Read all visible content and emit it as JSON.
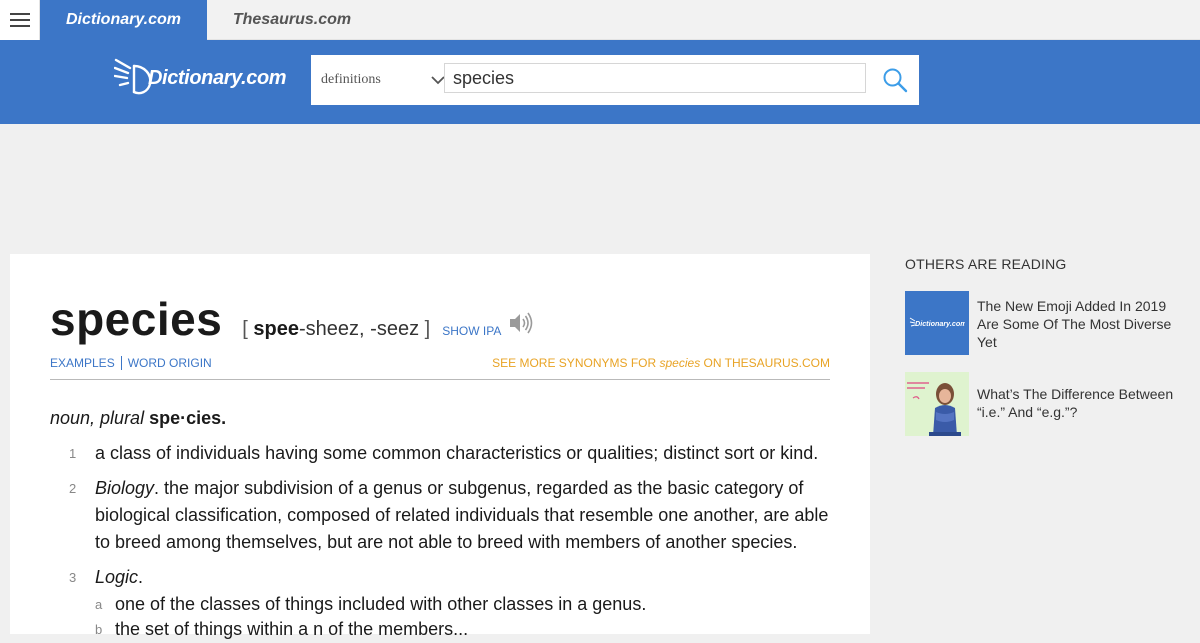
{
  "tabs": {
    "dictionary": "Dictionary.com",
    "thesaurus": "Thesaurus.com"
  },
  "header": {
    "logo_text": "Dictionary.com",
    "search_type": "definitions",
    "search_value": "species",
    "icons": [
      "menu-icon",
      "chevron-down-icon",
      "search-icon"
    ]
  },
  "entry": {
    "headword": "species",
    "pron_open": "[",
    "pron_stress": "spee",
    "pron_rest": "-sheez, -seez",
    "pron_close": "]",
    "show_ipa": "SHOW IPA",
    "links": {
      "examples": "EXAMPLES",
      "word_origin": "WORD ORIGIN",
      "synonyms_prefix": "SEE MORE SYNONYMS FOR",
      "synonyms_word": "species",
      "synonyms_suffix": "ON THESAURUS.COM"
    },
    "pos": "noun, plural",
    "plural_form": "spe·cies.",
    "definitions": [
      {
        "num": "1",
        "label": "",
        "text": "a class of individuals having some common characteristics or qualities; distinct sort or kind."
      },
      {
        "num": "2",
        "label": "Biology",
        "text": ". the major subdivision of a genus or subgenus, regarded as the basic category of biological classification, composed of related individuals that resemble one another, are able to breed among themselves, but are not able to breed with members of another species."
      },
      {
        "num": "3",
        "label": "Logic",
        "text": "."
      }
    ],
    "subdefinitions": [
      {
        "letter": "a",
        "text": "one of the classes of things included with other classes in a genus."
      },
      {
        "letter": "b",
        "text": "the set of things within a n of the members..."
      }
    ]
  },
  "sidebar": {
    "title": "OTHERS ARE READING",
    "articles": [
      {
        "title": "The New Emoji Added In 2019 Are Some Of The Most Diverse Yet",
        "thumb_text": "Dictionary.com"
      },
      {
        "title": "What’s The Difference Between “i.e.” And “e.g.”?"
      }
    ]
  },
  "colors": {
    "brand_blue": "#3c76c7",
    "synonym_orange": "#e8a325"
  }
}
